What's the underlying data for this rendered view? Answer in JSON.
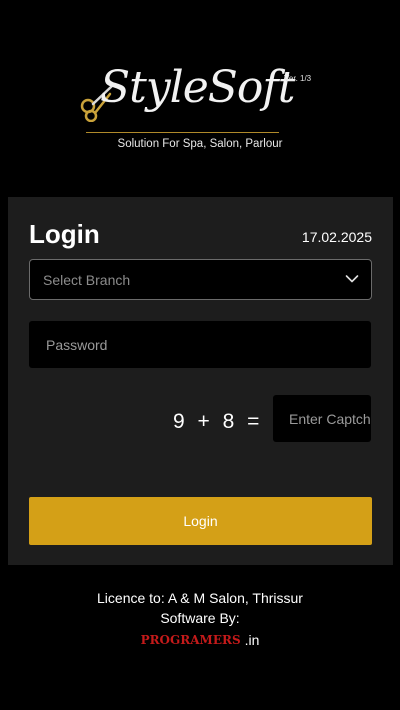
{
  "logo": {
    "name": "StyleSoft",
    "version": "Ver. 1/3",
    "tagline": "Solution For Spa, Salon, Parlour",
    "accent_color": "#b08a2a",
    "icon": "scissors-icon"
  },
  "login": {
    "title": "Login",
    "date": "17.02.2025",
    "branch_select": {
      "selected": "Select Branch",
      "icon": "chevron-down-icon"
    },
    "password": {
      "placeholder": "Password",
      "value": ""
    },
    "captcha": {
      "question": "9 + 8 =",
      "placeholder": "Enter Captcha",
      "value": ""
    },
    "submit_label": "Login",
    "button_color": "#d4a017"
  },
  "footer": {
    "licence": "Licence to: A & M Salon, Thrissur",
    "software_by": "Software By:",
    "brand": "PROGRAMERS",
    "brand_suffix": ".in",
    "brand_color": "#c41a1a"
  }
}
